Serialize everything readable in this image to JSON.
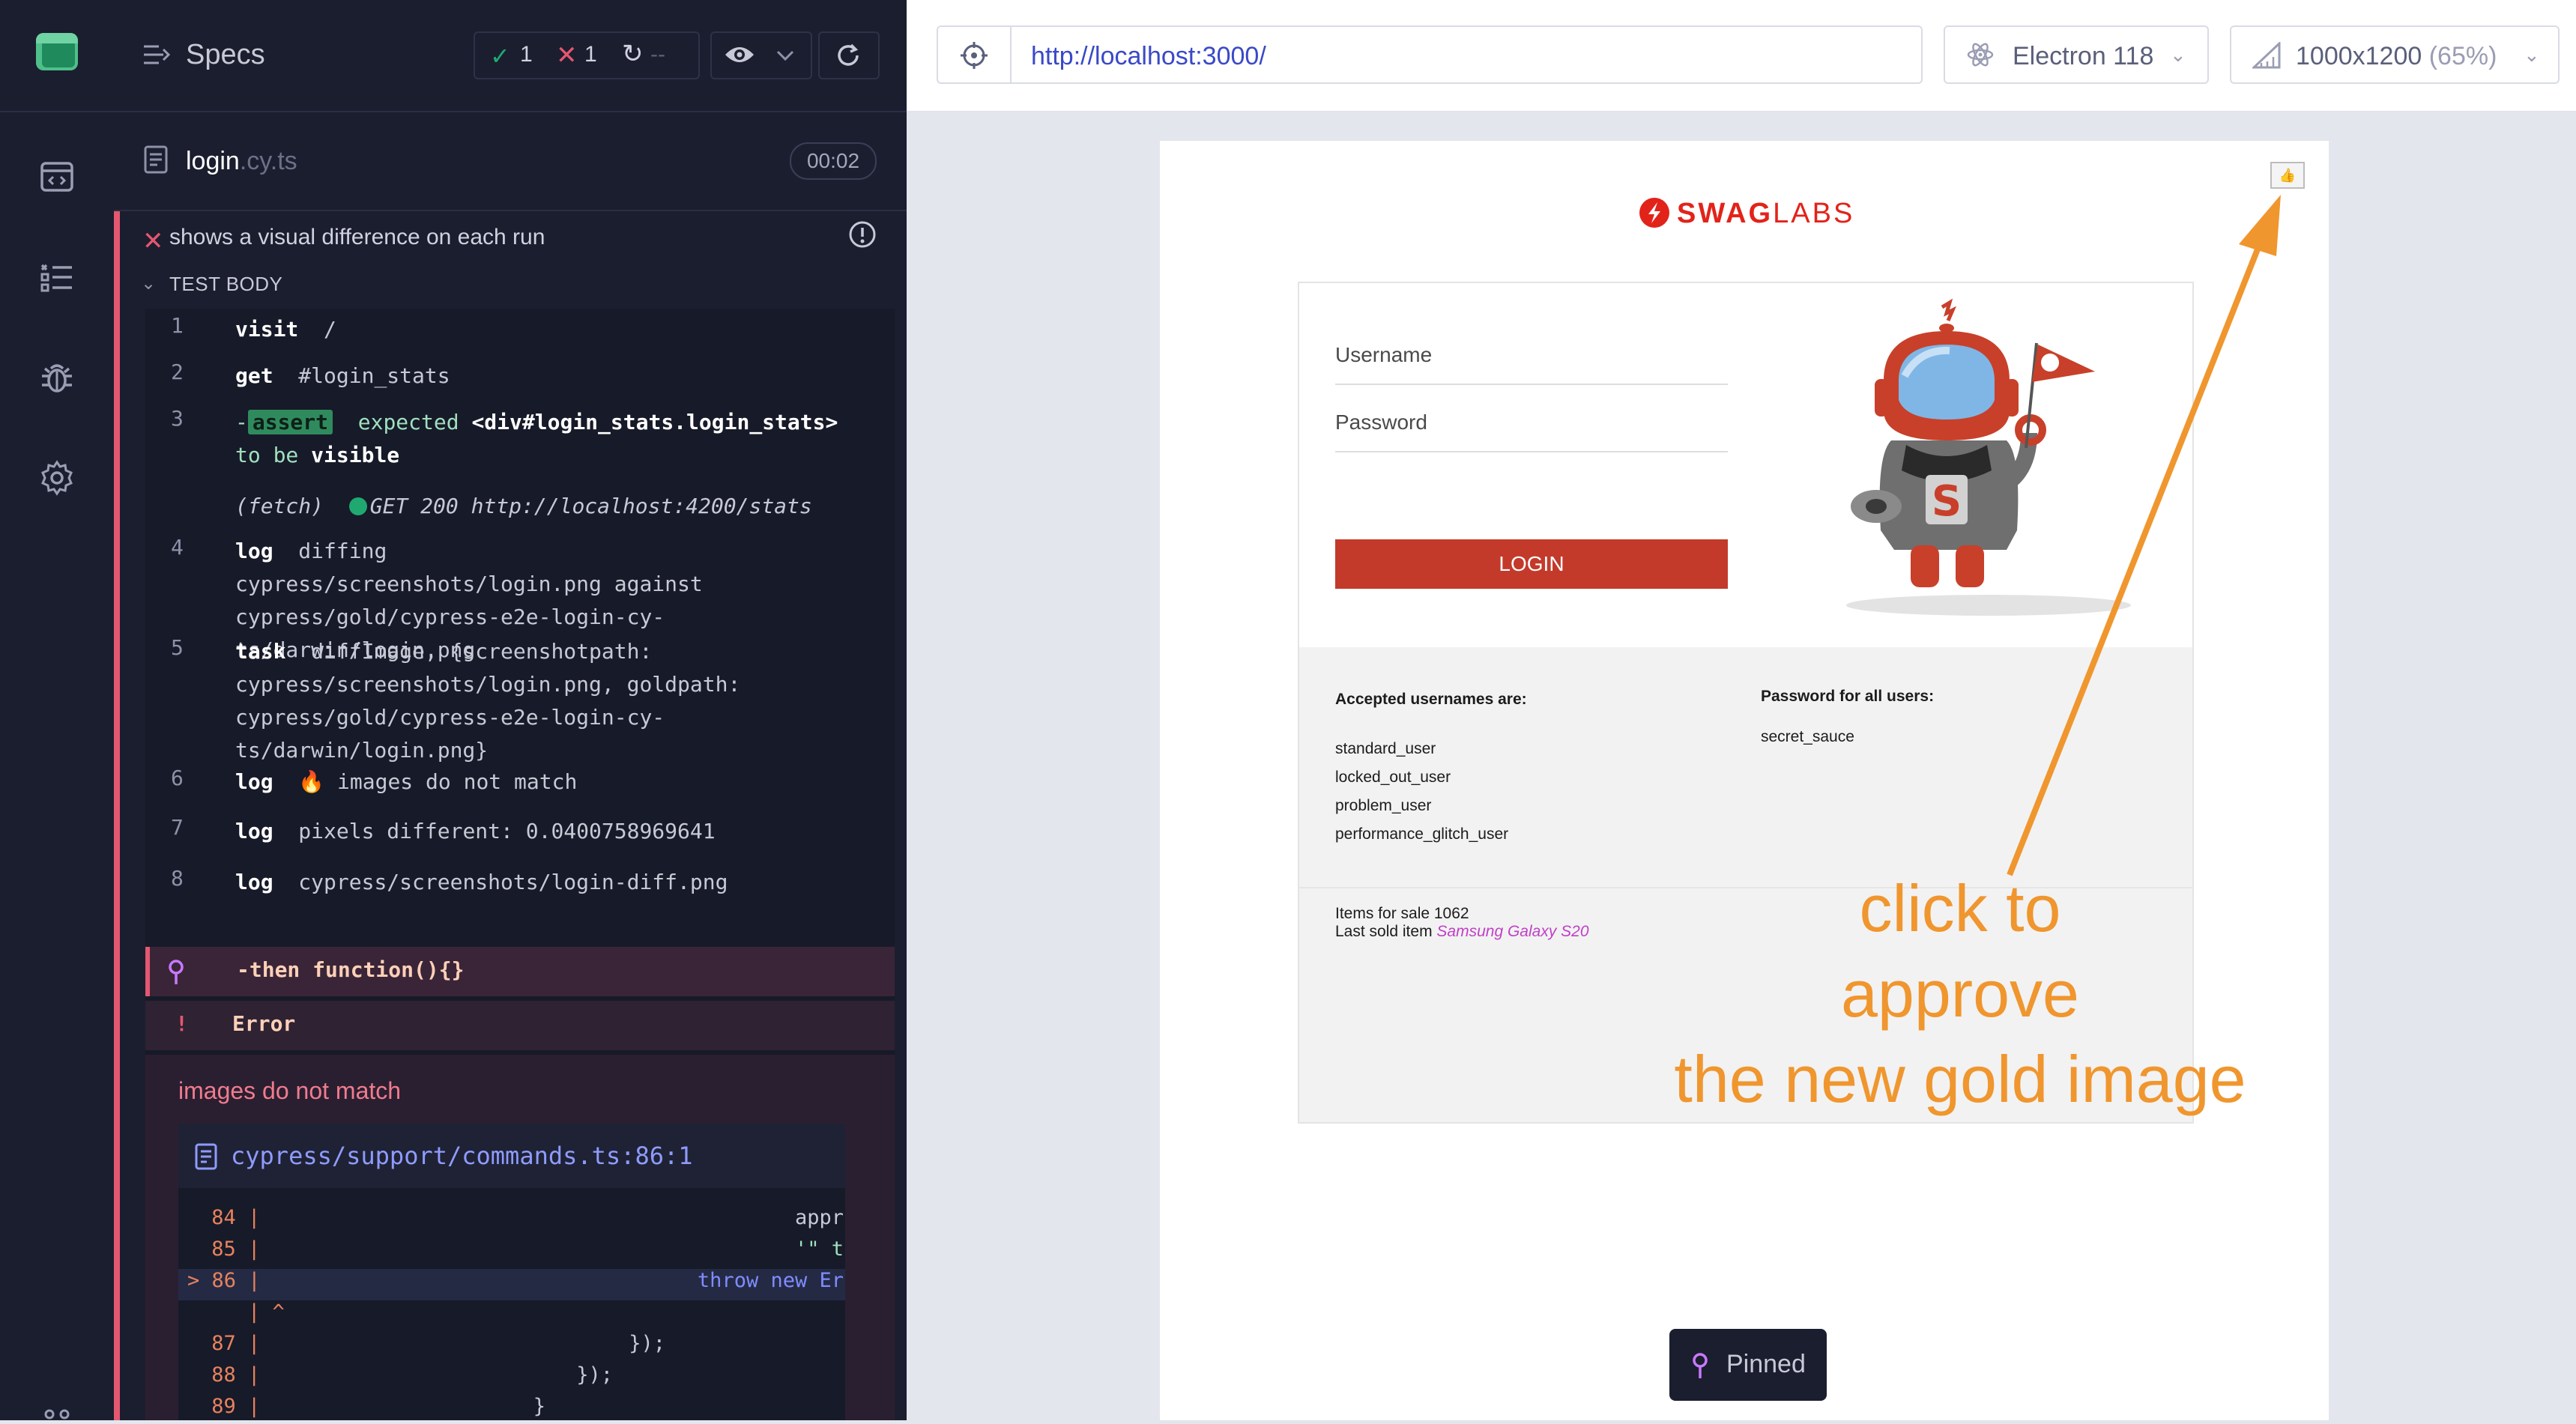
{
  "rail": {
    "logo": "cypress-logo",
    "items": [
      {
        "icon": "code-window-icon"
      },
      {
        "icon": "list-icon"
      },
      {
        "icon": "bug-icon"
      },
      {
        "icon": "settings-icon"
      }
    ]
  },
  "reporter": {
    "header": {
      "specs_label": "Specs",
      "passed": "1",
      "failed": "1",
      "pending": "--"
    },
    "spec": {
      "name": "login",
      "ext": ".cy.ts",
      "duration": "00:02"
    },
    "test": {
      "title": "shows a visual difference on each run",
      "section": "TEST BODY",
      "commands": [
        {
          "num": "1",
          "name": "visit",
          "message": "/"
        },
        {
          "num": "2",
          "name": "get",
          "message": "#login_stats"
        },
        {
          "num": "3",
          "name": "assert",
          "message_part1": "expected",
          "message_part2": "<div#login_stats.login_stats>",
          "message_part3": "to be",
          "message_part4": "visible"
        },
        {
          "num": "",
          "name": "(fetch)",
          "message": "GET 200 http://localhost:4200/stats"
        },
        {
          "num": "4",
          "name": "log",
          "message": "diffing cypress/screenshots/login.png against cypress/gold/cypress-e2e-login-cy-ts/darwin/login.png"
        },
        {
          "num": "5",
          "name": "task",
          "message": "diffImage, {screenshotpath: cypress/screenshots/login.png, goldpath: cypress/gold/cypress-e2e-login-cy-ts/darwin/login.png}"
        },
        {
          "num": "6",
          "name": "log",
          "message": "🔥 images do not match"
        },
        {
          "num": "7",
          "name": "log",
          "message": "pixels different: 0.0400758969641"
        },
        {
          "num": "8",
          "name": "log",
          "message": "cypress/screenshots/login-diff.png"
        }
      ],
      "then_cmd": "-then  function(){}",
      "error_bang": "!",
      "error_label": "Error",
      "error_message": "images do not match",
      "code_file": "cypress/support/commands.ts:86:1",
      "code_lines": [
        {
          "ln": " 84 |",
          "code": "appr"
        },
        {
          "ln": " 85 |",
          "code": "'\" t"
        },
        {
          "ln": "> 86 |",
          "code": "throw new Er"
        },
        {
          "ln": "    | ^",
          "code": ""
        },
        {
          "ln": " 87 |",
          "code": "});"
        },
        {
          "ln": " 88 |",
          "code": "});"
        },
        {
          "ln": " 89 |",
          "code": "}"
        }
      ]
    }
  },
  "aut": {
    "url": "http://localhost:3000/",
    "browser": "Electron 118",
    "viewport": "1000x1200",
    "viewport_pct": "(65%)",
    "page": {
      "logo_swag": "SWAG",
      "logo_labs": "LABS",
      "username_placeholder": "Username",
      "password_placeholder": "Password",
      "login_button": "LOGIN",
      "accepted_title": "Accepted usernames are:",
      "usernames": [
        "standard_user",
        "locked_out_user",
        "problem_user",
        "performance_glitch_user"
      ],
      "password_title": "Password for all users:",
      "password_value": "secret_sauce",
      "items_for_sale": "Items for sale 1062",
      "last_sold_label": "Last sold item",
      "last_sold_value": "Samsung Galaxy S20",
      "approve_icon": "👍"
    },
    "annotation_lines": [
      "click to",
      "approve",
      "the new gold image"
    ],
    "pinned_label": "Pinned"
  },
  "colors": {
    "fail": "#e45770",
    "pass": "#1fa971",
    "annotation": "#f0962e",
    "login_button": "#c33a2b"
  }
}
